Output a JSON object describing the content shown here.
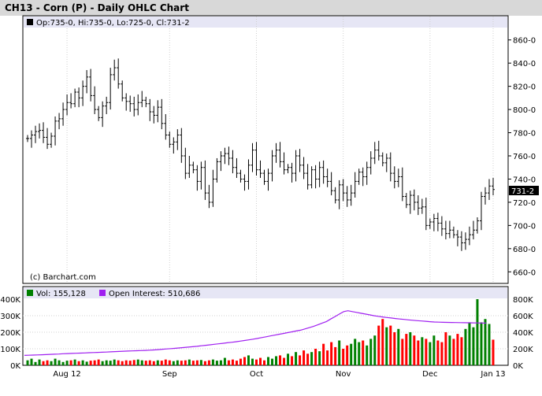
{
  "title": "CH13 - Corn (P) - Daily OHLC Chart",
  "price_panel": {
    "legend": "Op:735-0, Hi:735-0, Lo:725-0, Cl:731-2",
    "credit": "(c) Barchart.com",
    "last_label": "731-2"
  },
  "volume_panel": {
    "vol_legend": "Vol: 155,128",
    "oi_legend": "Open Interest: 510,686"
  },
  "colors": {
    "up": "#008000",
    "down": "#ff0000",
    "oi_line": "#a020f0",
    "legend_band": "#e6e6f5",
    "title_band": "#d8d8d8"
  },
  "chart_data": [
    {
      "type": "ohlc",
      "title": "CH13 - Corn (P) - Daily OHLC Chart",
      "ylim": [
        650,
        870
      ],
      "y_ticks": [
        "860-0",
        "840-0",
        "820-0",
        "800-0",
        "780-0",
        "760-0",
        "740-0",
        "720-0",
        "700-0",
        "680-0",
        "660-0"
      ],
      "x_ticks": [
        "Aug 12",
        "Sep",
        "Oct",
        "Nov",
        "Dec",
        "Jan 13"
      ],
      "ohlc_closes": [
        775,
        778,
        781,
        782,
        776,
        770,
        777,
        790,
        792,
        800,
        806,
        805,
        815,
        810,
        820,
        828,
        812,
        800,
        793,
        803,
        806,
        830,
        836,
        822,
        810,
        807,
        805,
        800,
        806,
        808,
        805,
        798,
        795,
        802,
        788,
        778,
        770,
        772,
        778,
        760,
        745,
        752,
        748,
        738,
        750,
        728,
        720,
        740,
        755,
        760,
        762,
        758,
        750,
        745,
        740,
        738,
        752,
        765,
        748,
        745,
        738,
        745,
        760,
        765,
        755,
        748,
        750,
        745,
        760,
        752,
        745,
        735,
        748,
        740,
        750,
        742,
        738,
        730,
        722,
        735,
        728,
        722,
        728,
        738,
        746,
        742,
        750,
        758,
        765,
        760,
        754,
        758,
        745,
        738,
        742,
        725,
        718,
        726,
        720,
        715,
        716,
        700,
        703,
        706,
        702,
        697,
        693,
        696,
        692,
        690,
        685,
        688,
        692,
        696,
        704,
        725,
        728,
        734,
        731
      ],
      "volume_k": [
        30,
        40,
        20,
        35,
        25,
        30,
        25,
        40,
        30,
        20,
        28,
        30,
        35,
        25,
        30,
        22,
        28,
        30,
        35,
        25,
        30,
        28,
        35,
        30,
        25,
        30,
        28,
        32,
        35,
        30,
        28,
        30,
        25,
        30,
        28,
        35,
        30,
        25,
        30,
        28,
        30,
        35,
        28,
        30,
        32,
        25,
        30,
        35,
        28,
        30,
        45,
        30,
        35,
        28,
        40,
        50,
        60,
        40,
        35,
        45,
        30,
        50,
        40,
        55,
        60,
        45,
        70,
        55,
        80,
        60,
        90,
        70,
        80,
        100,
        85,
        130,
        90,
        140,
        110,
        150,
        100,
        120,
        130,
        160,
        140,
        150,
        120,
        160,
        180,
        240,
        280,
        230,
        240,
        200,
        220,
        160,
        190,
        200,
        180,
        150,
        170,
        160,
        140,
        180,
        150,
        140,
        200,
        180,
        160,
        190,
        170,
        220,
        260,
        230,
        420,
        260,
        280,
        250,
        155
      ],
      "open_interest_k": [
        120,
        122,
        124,
        126,
        128,
        130,
        132,
        134,
        136,
        140,
        142,
        144,
        146,
        148,
        150,
        152,
        154,
        156,
        158,
        160,
        163,
        166,
        168,
        170,
        172,
        174,
        176,
        178,
        180,
        183,
        186,
        190,
        194,
        198,
        202,
        206,
        210,
        215,
        220,
        225,
        230,
        236,
        242,
        248,
        254,
        260,
        266,
        272,
        278,
        285,
        292,
        300,
        308,
        316,
        325,
        335,
        345,
        355,
        365,
        375,
        385,
        395,
        405,
        415,
        425,
        440,
        455,
        470,
        490,
        510,
        530,
        560,
        590,
        620,
        650,
        660,
        650,
        640,
        630,
        620,
        610,
        600,
        592,
        585,
        578,
        572,
        566,
        560,
        555,
        550,
        545,
        540,
        536,
        532,
        528,
        524,
        522,
        520,
        519,
        518,
        517,
        516,
        515,
        514,
        513,
        512,
        511,
        510.686
      ],
      "volume_ylim": [
        0,
        400
      ],
      "volume_ticks_left": [
        "400K",
        "300K",
        "200K",
        "100K",
        "0K"
      ],
      "oi_ylim": [
        0,
        800
      ],
      "oi_ticks_right": [
        "800K",
        "600K",
        "400K",
        "200K",
        "0K"
      ]
    }
  ]
}
